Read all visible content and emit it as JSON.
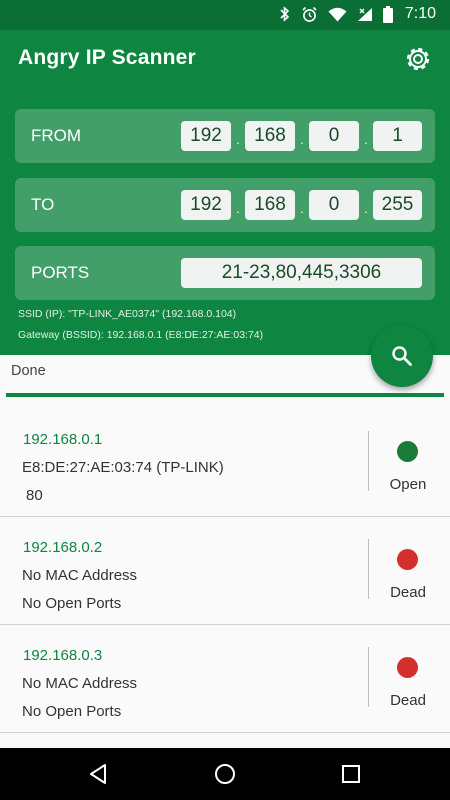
{
  "status_bar": {
    "time": "7:10"
  },
  "app_bar": {
    "title": "Angry IP Scanner"
  },
  "range": {
    "from_label": "FROM",
    "from": [
      "192",
      "168",
      "0",
      "1"
    ],
    "to_label": "TO",
    "to": [
      "192",
      "168",
      "0",
      "255"
    ],
    "ports_label": "PORTS",
    "ports": "21-23,80,445,3306",
    "separator": "."
  },
  "network": {
    "ssid": "SSID (IP): \"TP-LINK_AE0374\" (192.168.0.104)",
    "gateway": "Gateway (BSSID): 192.168.0.1 (E8:DE:27:AE:03:74)"
  },
  "scan": {
    "status": "Done",
    "progress": 1.0
  },
  "results": [
    {
      "ip": "192.168.0.1",
      "mac": "E8:DE:27:AE:03:74 (TP-LINK)",
      "ports": "80",
      "state": "Open",
      "state_color": "#1a7a3a"
    },
    {
      "ip": "192.168.0.2",
      "mac": "No MAC Address",
      "ports": "No Open Ports",
      "state": "Dead",
      "state_color": "#d32f2f"
    },
    {
      "ip": "192.168.0.3",
      "mac": "No MAC Address",
      "ports": "No Open Ports",
      "state": "Dead",
      "state_color": "#d32f2f"
    }
  ],
  "icons": {
    "status": [
      "bluetooth-icon",
      "alarm-icon",
      "wifi-icon",
      "signal-icon",
      "battery-icon"
    ],
    "settings": "gear-icon",
    "fab": "search-icon",
    "nav": [
      "back-icon",
      "home-icon",
      "recents-icon"
    ]
  },
  "colors": {
    "primary": "#0e8540",
    "status_bar": "#0a6e35",
    "open": "#1a7a3a",
    "dead": "#d32f2f"
  }
}
